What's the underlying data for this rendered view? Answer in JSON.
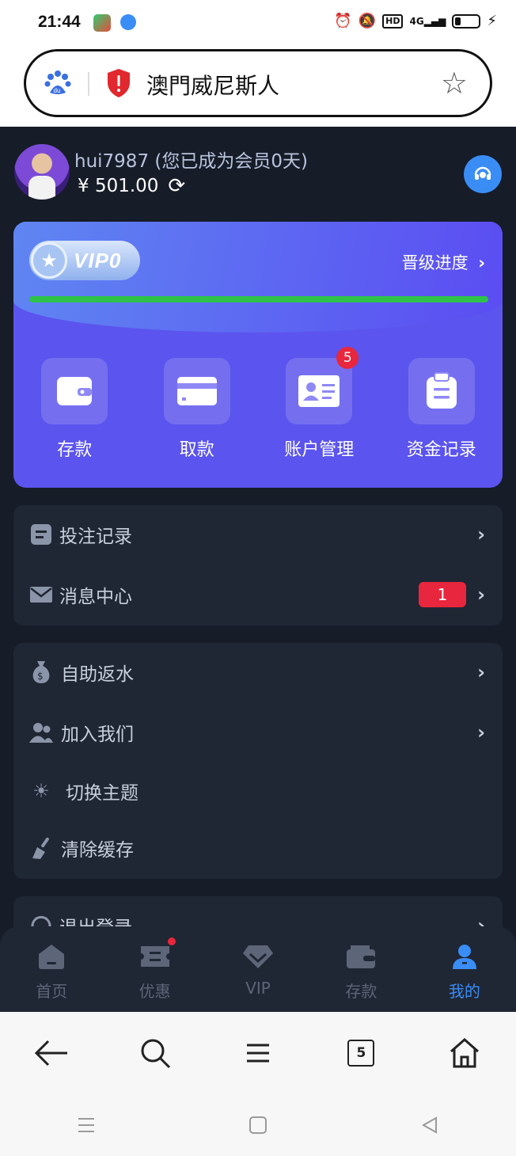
{
  "status": {
    "time": "21:44",
    "hd": "HD",
    "network": "4G"
  },
  "address": {
    "title": "澳門威尼斯人"
  },
  "profile": {
    "username": "hui7987 (您已成为会员0天)",
    "balance": "¥ 501.00"
  },
  "vip": {
    "level_label": "VIP0",
    "progress_label": "晋级进度",
    "progress_value": 1.0
  },
  "actions": [
    {
      "label": "存款",
      "icon": "wallet-icon"
    },
    {
      "label": "取款",
      "icon": "card-icon"
    },
    {
      "label": "账户管理",
      "icon": "id-card-icon",
      "badge": "5"
    },
    {
      "label": "资金记录",
      "icon": "clipboard-icon"
    }
  ],
  "menu1": [
    {
      "label": "投注记录",
      "icon": "document-icon"
    },
    {
      "label": "消息中心",
      "icon": "mail-icon",
      "badge": "1"
    }
  ],
  "menu2": [
    {
      "label": "自助返水",
      "icon": "money-bag-icon"
    },
    {
      "label": "加入我们",
      "icon": "users-icon"
    },
    {
      "label": "切换主题",
      "icon": "sun-icon"
    },
    {
      "label": "清除缓存",
      "icon": "broom-icon"
    }
  ],
  "menu3": [
    {
      "label": "退出登录",
      "icon": "logout-icon"
    }
  ],
  "tabs": [
    {
      "label": "首页",
      "icon": "home-icon"
    },
    {
      "label": "优惠",
      "icon": "ticket-icon"
    },
    {
      "label": "VIP",
      "icon": "diamond-icon"
    },
    {
      "label": "存款",
      "icon": "wallet-icon"
    },
    {
      "label": "我的",
      "icon": "user-icon",
      "active": true
    }
  ],
  "browser": {
    "tab_count": "5"
  },
  "colors": {
    "accent": "#3a8df5",
    "page_bg": "#161c28",
    "panel_bg": "#1f2634",
    "vip_purple": "#5b54ee",
    "progress_green": "#2ec24a",
    "badge_red": "#e8263d"
  }
}
